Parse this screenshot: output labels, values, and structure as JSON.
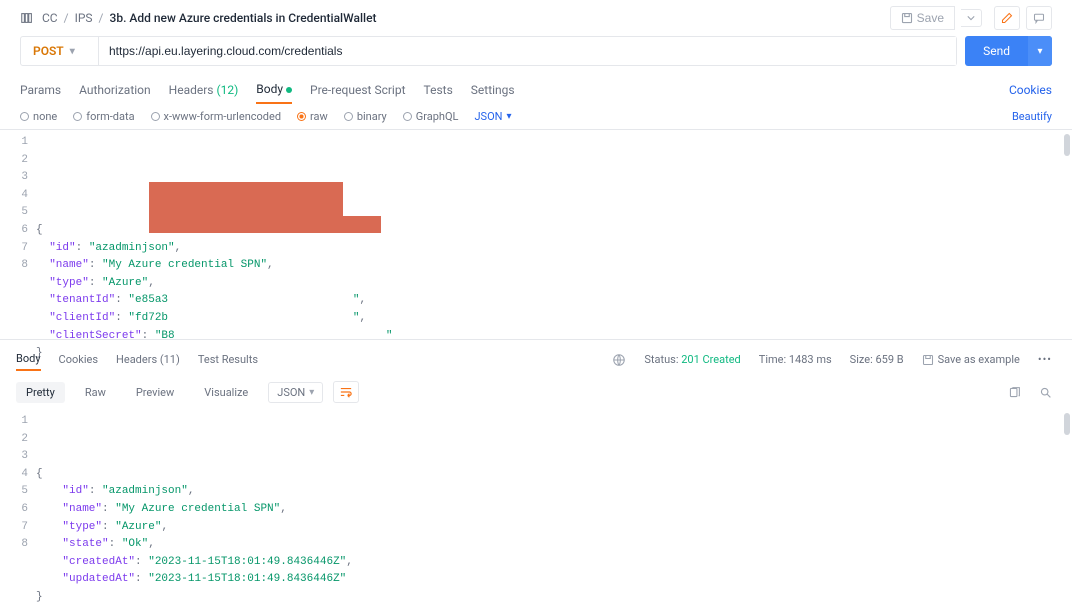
{
  "breadcrumb": {
    "workspace_icon": "folder",
    "parts": [
      "CC",
      "IPS"
    ],
    "current": "3b. Add new Azure credentials in CredentialWallet"
  },
  "header_actions": {
    "save_label": "Save"
  },
  "request": {
    "method": "POST",
    "url": "https://api.eu.layering.cloud.com/credentials",
    "send_label": "Send"
  },
  "req_tabs": {
    "params": "Params",
    "auth": "Authorization",
    "headers": "Headers",
    "headers_count": "(12)",
    "body": "Body",
    "prereq": "Pre-request Script",
    "tests": "Tests",
    "settings": "Settings",
    "cookies": "Cookies"
  },
  "body_types": {
    "none": "none",
    "formdata": "form-data",
    "xwww": "x-www-form-urlencoded",
    "raw": "raw",
    "binary": "binary",
    "graphql": "GraphQL",
    "json": "JSON",
    "beautify": "Beautify"
  },
  "request_body": {
    "lines": [
      "1",
      "2",
      "3",
      "4",
      "5",
      "6",
      "7",
      "8"
    ],
    "pairs": [
      {
        "k": "id",
        "v": "azadminjson"
      },
      {
        "k": "name",
        "v": "My Azure credential SPN"
      },
      {
        "k": "type",
        "v": "Azure"
      },
      {
        "k": "tenantId",
        "v_prefix": "e85a3"
      },
      {
        "k": "clientId",
        "v_prefix": "fd72b"
      },
      {
        "k": "clientSecret",
        "v_prefix": "B8"
      }
    ]
  },
  "response": {
    "tabs": {
      "body": "Body",
      "cookies": "Cookies",
      "headers": "Headers",
      "headers_count": "(11)",
      "tests": "Test Results"
    },
    "status_label": "Status:",
    "status_value": "201 Created",
    "time_label": "Time:",
    "time_value": "1483 ms",
    "size_label": "Size:",
    "size_value": "659 B",
    "save_example": "Save as example",
    "view": {
      "pretty": "Pretty",
      "raw": "Raw",
      "preview": "Preview",
      "visualize": "Visualize",
      "json": "JSON"
    },
    "body_lines": [
      "1",
      "2",
      "3",
      "4",
      "5",
      "6",
      "7",
      "8"
    ],
    "body": [
      {
        "k": "id",
        "v": "azadminjson"
      },
      {
        "k": "name",
        "v": "My Azure credential SPN"
      },
      {
        "k": "type",
        "v": "Azure"
      },
      {
        "k": "state",
        "v": "Ok"
      },
      {
        "k": "createdAt",
        "v": "2023-11-15T18:01:49.8436446Z"
      },
      {
        "k": "updatedAt",
        "v": "2023-11-15T18:01:49.8436446Z"
      }
    ]
  }
}
